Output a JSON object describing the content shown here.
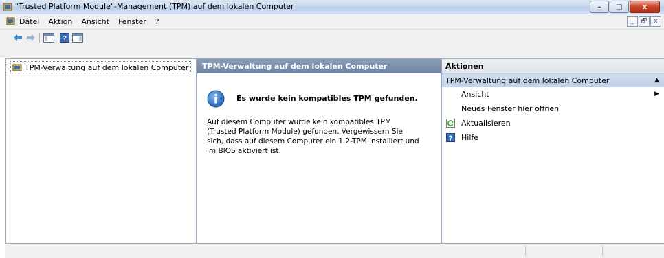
{
  "window": {
    "title": "\"Trusted Platform Module\"-Management (TPM) auf dem lokalen Computer",
    "controls": {
      "minimize": "–",
      "maximize": "□",
      "close": "x"
    }
  },
  "menubar": {
    "items": [
      "Datei",
      "Aktion",
      "Ansicht",
      "Fenster",
      "?"
    ],
    "mdi": {
      "minimize": "_",
      "restore": "🗗",
      "close": "x"
    }
  },
  "tree": {
    "items": [
      {
        "label": "TPM-Verwaltung auf dem lokalen Computer",
        "icon": "tpm-chip-icon"
      }
    ]
  },
  "main": {
    "header": "TPM-Verwaltung auf dem lokalen Computer",
    "message_title": "Es wurde kein kompatibles TPM gefunden.",
    "message_body": "Auf diesem Computer wurde kein kompatibles TPM (Trusted Platform Module) gefunden. Vergewissern Sie sich, dass auf diesem Computer ein 1.2-TPM installiert und im BIOS aktiviert ist."
  },
  "actions": {
    "header": "Aktionen",
    "section": "TPM-Verwaltung auf dem lokalen Computer",
    "items": [
      {
        "label": "Ansicht",
        "has_submenu": true
      },
      {
        "label": "Neues Fenster hier öffnen"
      },
      {
        "label": "Aktualisieren",
        "icon": "refresh-icon"
      },
      {
        "label": "Hilfe",
        "icon": "help-icon"
      }
    ]
  },
  "colors": {
    "title_bar": "#c4d6ec",
    "panel_header": "#7a8fab",
    "action_section": "#c8d6ec",
    "close_button": "#c8442a"
  }
}
